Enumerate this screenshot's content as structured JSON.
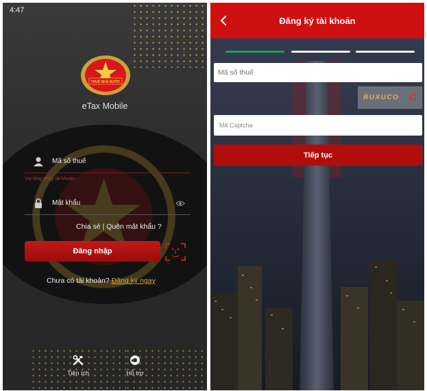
{
  "left_screen": {
    "status_time": "4:47",
    "emblem_text": "THUẾ NHÀ NƯỚC",
    "app_name": "eTax Mobile",
    "username_placeholder": "Mã số thuế",
    "error_message": "Vui lòng nhập tài khoản",
    "password_placeholder": "Mật khẩu",
    "links_line": "Chia sẻ  | Quên mật khẩu ?",
    "login_label": "Đăng nhập",
    "no_account_text": "Chưa có tài khoản?",
    "register_link": "Đăng ký ngay",
    "nav": {
      "util_label": "Tiện ích",
      "help_label": "Hỗ trợ"
    },
    "colors": {
      "accent_red": "#c21a1a",
      "link_gold": "#d9a93a"
    }
  },
  "right_screen": {
    "header_title": "Đăng ký tài khoản",
    "progress": {
      "total_steps": 3,
      "current_step": 1
    },
    "tax_code_placeholder": "Mã số thuế",
    "captcha_text": "RUXUCO",
    "captcha_placeholder": "Mã Captcha",
    "continue_label": "Tiếp tục",
    "colors": {
      "header_red": "#cf1010",
      "progress_green": "#21a05a"
    }
  }
}
